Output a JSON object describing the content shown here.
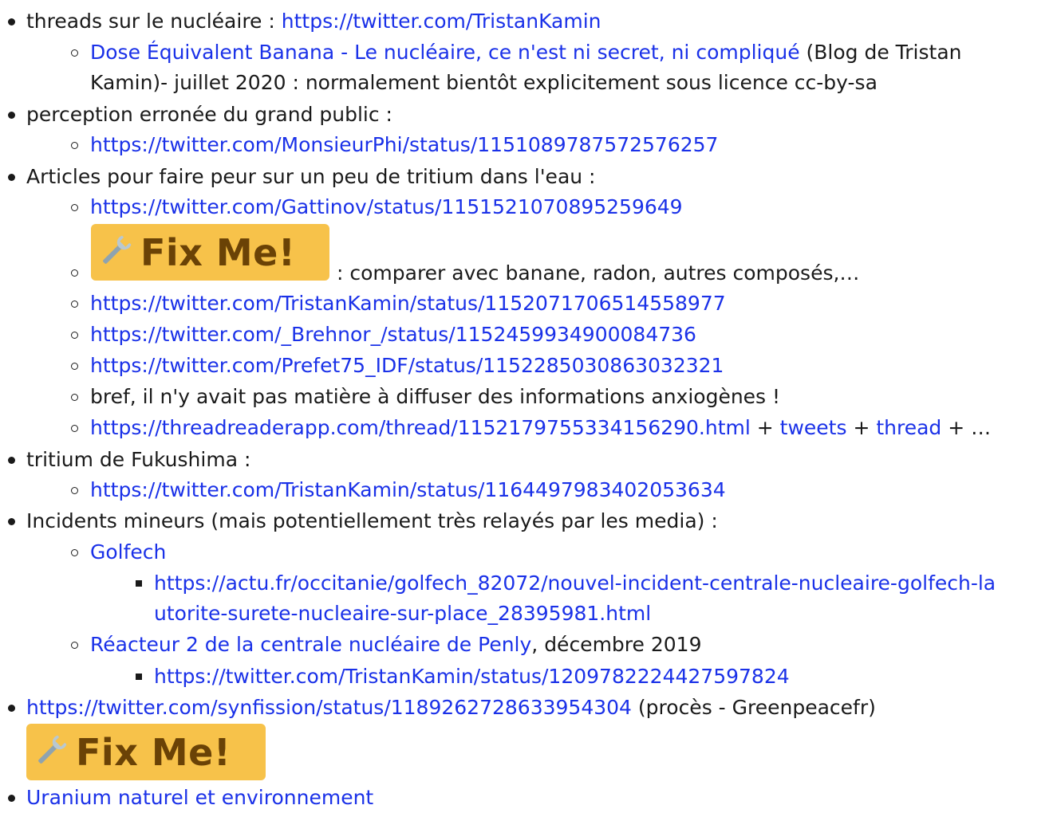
{
  "items": {
    "threads_label": "threads sur le nucléaire : ",
    "threads_link": "https://twitter.com/TristanKamin",
    "dose_link": "Dose Équivalent Banana - Le nucléaire, ce n'est ni secret, ni compliqué",
    "dose_text1": " (Blog de Tristan",
    "dose_text2": "Kamin)- juillet 2020 : normalement bientôt explicitement sous licence cc-by-sa",
    "perception_label": "perception erronée du grand public :",
    "perception_link": "https://twitter.com/MonsieurPhi/status/1151089787572576257",
    "articles_label": "Articles pour faire peur sur un peu de tritium dans l'eau :",
    "gattinov_link": "https://twitter.com/Gattinov/status/1151521070895259649",
    "fixme_label": "Fix Me!",
    "fixme_note": " : comparer avec banane, radon, autres composés,…",
    "tk_link1": "https://twitter.com/TristanKamin/status/1152071706514558977",
    "brehnor_link": "https://twitter.com/_Brehnor_/status/1152459934900084736",
    "prefet_link": "https://twitter.com/Prefet75_IDF/status/1152285030863032321",
    "bref_text": "bref, il n'y avait pas matière à diffuser des informations anxiogènes !",
    "threadreader_link": "https://threadreaderapp.com/thread/1152179755334156290.html",
    "plus1": " + ",
    "tweets_link": "tweets",
    "plus2": " + ",
    "thread_link": "thread",
    "plus_etc": " + …",
    "fukushima_label": "tritium de Fukushima :",
    "fukushima_link": "https://twitter.com/TristanKamin/status/1164497983402053634",
    "incidents_label": "Incidents mineurs (mais potentiellement très relayés par les media) :",
    "golfech_link": "Golfech",
    "actu_link1": "https://actu.fr/occitanie/golfech_82072/nouvel-incident-centrale-nucleaire-golfech-la",
    "actu_link2": "utorite-surete-nucleaire-sur-place_28395981.html",
    "penly_link": "Réacteur 2 de la centrale nucléaire de Penly",
    "penly_text": ", décembre 2019",
    "penly_tweet_link": "https://twitter.com/TristanKamin/status/1209782224427597824",
    "synfission_link": "https://twitter.com/synfission/status/1189262728633954304",
    "synfission_text": " (procès - Greenpeacefr)",
    "uranium_link": "Uranium naturel et environnement"
  },
  "colors": {
    "link": "#1a31e8",
    "text": "#1a1a1a",
    "fixme_bg": "#f7c24a",
    "fixme_text": "#6a4206"
  },
  "icons": [
    "wrench-icon"
  ]
}
